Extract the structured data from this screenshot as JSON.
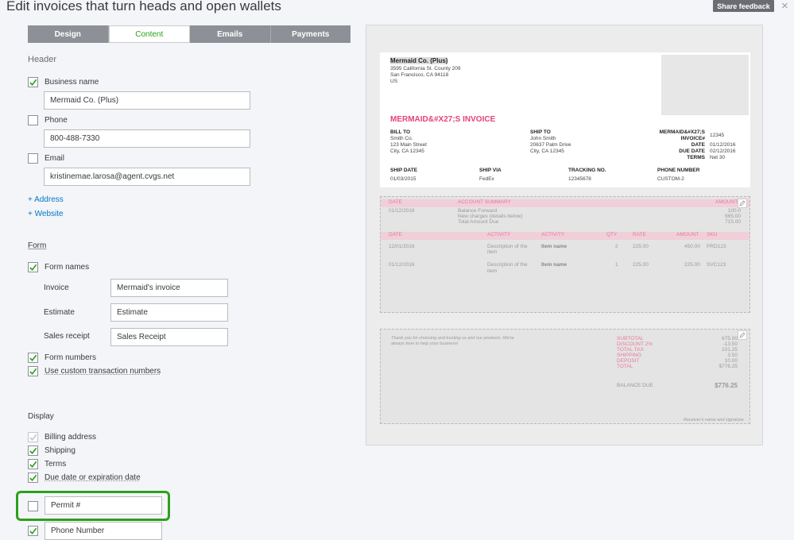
{
  "title": "Edit invoices that turn heads and open wallets",
  "share_feedback": "Share feedback",
  "close": "×",
  "tabs": [
    "Design",
    "Content",
    "Emails",
    "Payments"
  ],
  "header": {
    "heading": "Header",
    "business_name_label": "Business name",
    "business_name_value": "Mermaid Co. (Plus)",
    "phone_label": "Phone",
    "phone_value": "800-488-7330",
    "email_label": "Email",
    "email_value": "kristinemae.larosa@agent.cvgs.net",
    "add_address": "+ Address",
    "add_website": "+ Website"
  },
  "form": {
    "heading": "Form",
    "form_names": "Form names",
    "invoice_label": "Invoice",
    "invoice_value": "Mermaid's invoice",
    "estimate_label": "Estimate",
    "estimate_value": "Estimate",
    "sales_receipt_label": "Sales receipt",
    "sales_receipt_value": "Sales Receipt",
    "form_numbers": "Form numbers",
    "custom_numbers": "Use custom transaction numbers"
  },
  "display": {
    "heading": "Display",
    "billing_address": "Billing address",
    "shipping": "Shipping",
    "terms": "Terms",
    "due_date": "Due date or expiration date",
    "permit": "Permit #",
    "phone_number": "Phone Number"
  },
  "preview": {
    "company": "Mermaid Co. (Plus)",
    "addr1": "3595 California St. County 209",
    "addr2": "San Francisco, CA 94118",
    "addr3": "US",
    "invoice_title": "MERMAID&#X27;S INVOICE",
    "bill_to": "BILL TO",
    "bill_lines": [
      "Smith Co.",
      "123 Main Street",
      "City, CA 12345"
    ],
    "ship_to": "SHIP TO",
    "ship_lines": [
      "John Smith",
      "20637 Palm Drive",
      "City, CA 12345"
    ],
    "meta_labels": [
      "MERMAID&#X27;S",
      "INVOICE#",
      "DATE",
      "DUE DATE",
      "TERMS"
    ],
    "meta_values": [
      "12345",
      "",
      "01/12/2016",
      "02/12/2016",
      "Net 30"
    ],
    "ship_date_h": "SHIP DATE",
    "ship_date": "01/03/2015",
    "ship_via_h": "SHIP VIA",
    "ship_via": "FedEx",
    "tracking_h": "TRACKING NO.",
    "tracking": "12345678",
    "phone_h": "PHONE NUMBER",
    "phone": "CUSTOM-2",
    "acct_date_h": "DATE",
    "acct_summary_h": "ACCOUNT SUMMARY",
    "acct_amount_h": "AMOUNT",
    "acct_date": "01/12/2016",
    "acct_lines": [
      "Balance Forward",
      "New charges (details below)",
      "Total Amount Due"
    ],
    "acct_amounts": [
      "100.0",
      "665.00",
      "715.00"
    ],
    "cols": [
      "DATE",
      "ACTIVITY",
      "ACTIVITY",
      "QTY",
      "RATE",
      "AMOUNT",
      "SKU"
    ],
    "rows": [
      {
        "date": "12/01/2016",
        "desc1": "Description of the",
        "desc2": "item",
        "item": "Item name",
        "qty": "2",
        "rate": "225.00",
        "amount": "450.00",
        "sku": "PRD123"
      },
      {
        "date": "01/12/2016",
        "desc1": "Description of the",
        "desc2": "item",
        "item": "Item name",
        "qty": "1",
        "rate": "225.00",
        "amount": "225.00",
        "sku": "SVC123"
      }
    ],
    "thanks1": "Thank you for choosing and trusting us and our products. We're",
    "thanks2": "always here to help your business!",
    "total_labels": [
      "SUBTOTAL",
      "DISCOUNT 2%",
      "TOTAL TAX",
      "SHIPPING",
      "DEPOSIT",
      "TOTAL"
    ],
    "total_values": [
      "675.00",
      "-13.50",
      "101.25",
      "3.50",
      "10.00",
      "$776.25"
    ],
    "balance_due_label": "BALANCE DUE",
    "balance_due": "$776.25",
    "signature": "Receiver's name and signature"
  }
}
